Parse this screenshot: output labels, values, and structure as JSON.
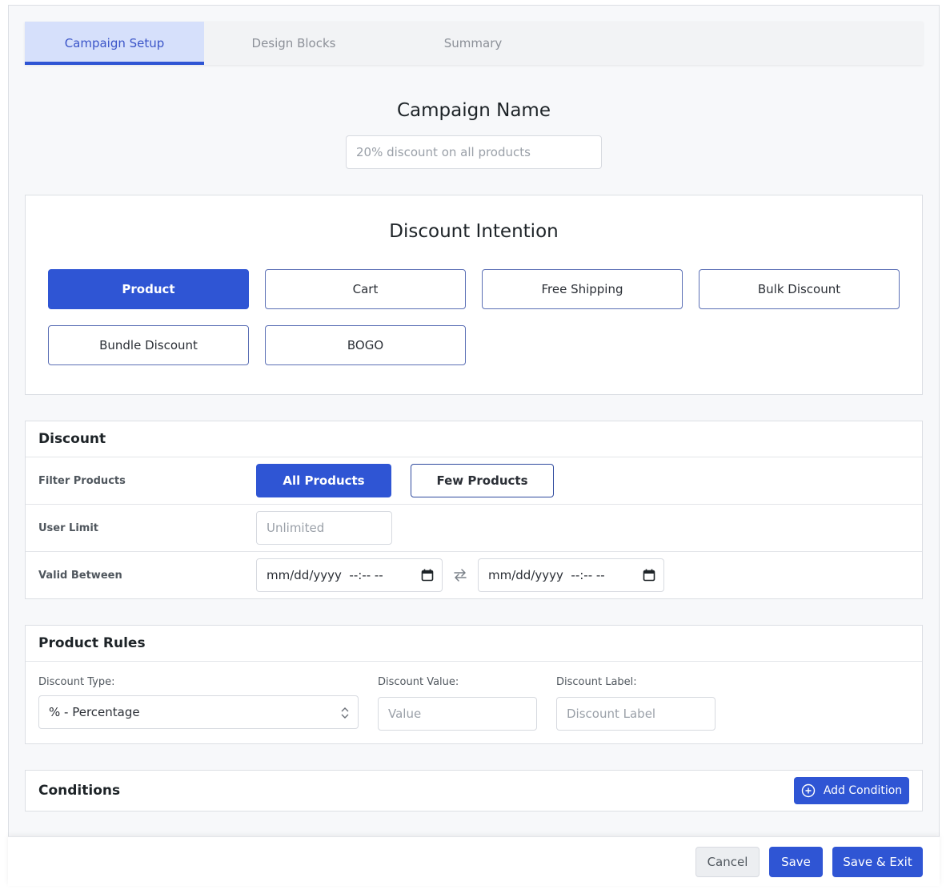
{
  "tabs": [
    {
      "label": "Campaign Setup",
      "active": true
    },
    {
      "label": "Design Blocks",
      "active": false
    },
    {
      "label": "Summary",
      "active": false
    }
  ],
  "campaign": {
    "heading": "Campaign Name",
    "name_value": "",
    "name_placeholder": "20% discount on all products"
  },
  "intention": {
    "heading": "Discount Intention",
    "options": [
      {
        "label": "Product",
        "selected": true
      },
      {
        "label": "Cart",
        "selected": false
      },
      {
        "label": "Free Shipping",
        "selected": false
      },
      {
        "label": "Bulk Discount",
        "selected": false
      },
      {
        "label": "Bundle Discount",
        "selected": false
      },
      {
        "label": "BOGO",
        "selected": false
      }
    ]
  },
  "discount": {
    "title": "Discount",
    "filter_label": "Filter Products",
    "filter_options": [
      {
        "label": "All Products",
        "selected": true
      },
      {
        "label": "Few Products",
        "selected": false
      }
    ],
    "user_limit_label": "User Limit",
    "user_limit_placeholder": "Unlimited",
    "valid_between_label": "Valid Between",
    "start_date": "mm/dd/yyyy  --:-- --",
    "end_date": "mm/dd/yyyy  --:-- --"
  },
  "product_rules": {
    "title": "Product Rules",
    "type_label": "Discount Type:",
    "type_value": "% - Percentage",
    "value_label": "Discount Value:",
    "value_placeholder": "Value",
    "label_label": "Discount Label:",
    "label_placeholder": "Discount Label"
  },
  "conditions": {
    "title": "Conditions",
    "add_label": "Add Condition"
  },
  "footer": {
    "cancel_label": "Cancel",
    "save_label": "Save",
    "save_exit_label": "Save & Exit"
  },
  "colors": {
    "primary": "#2f55d4",
    "tab_active_bg": "#d6e0fb",
    "page_bg": "#f7f8fa"
  }
}
